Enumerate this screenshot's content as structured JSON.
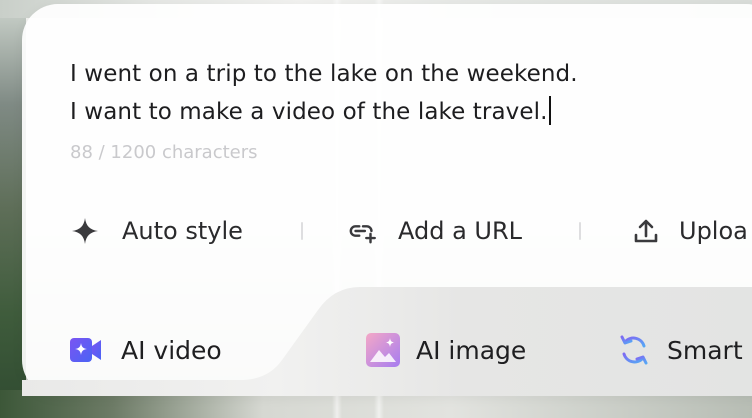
{
  "prompt": {
    "lines": [
      "I went on a trip to the lake on the weekend.",
      "I want to make a video of the lake travel."
    ],
    "char_count": "88 / 1200 characters"
  },
  "options": {
    "auto_style": {
      "label": "Auto style",
      "icon": "sparkle-icon"
    },
    "add_url": {
      "label": "Add a URL",
      "icon": "link-add-icon"
    },
    "upload": {
      "label": "Uploa",
      "icon": "upload-icon"
    }
  },
  "tabs": [
    {
      "label": "AI video",
      "icon": "video-camera-icon",
      "active": true
    },
    {
      "label": "AI image",
      "icon": "image-icon",
      "active": false
    },
    {
      "label": "Smart",
      "icon": "refresh-cycle-icon",
      "active": false
    }
  ],
  "colors": {
    "text": "#1d1d1f",
    "muted": "#c9c9cc",
    "video_gradient": [
      "#6f52f0",
      "#4a63f5"
    ],
    "image_gradient": [
      "#f2a6c8",
      "#a77bef"
    ],
    "smart_gradient": [
      "#7c6cf3",
      "#54a6f5"
    ]
  }
}
